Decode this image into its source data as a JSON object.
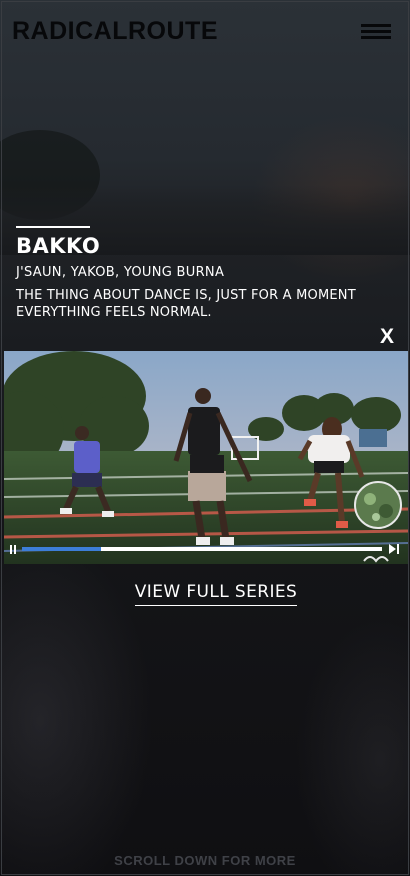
{
  "header": {
    "logo": "RADICALROUTE",
    "menu_icon": "hamburger-menu-icon"
  },
  "feature": {
    "title": "BAKKO",
    "artists": "J'SAUN, YAKOB, YOUNG BURNA",
    "quote": "THE THING ABOUT DANCE IS, JUST FOR A MOMENT EVERYTHING FEELS NORMAL."
  },
  "overlay": {
    "close_label": "X"
  },
  "video": {
    "description_icon": "dance-video-thumbnail",
    "progress": 0.22,
    "pause_icon": "pause-icon",
    "next_icon": "skip-next-icon"
  },
  "cta": {
    "view_full_series": "VIEW FULL SERIES"
  },
  "footer": {
    "scroll_hint": "SCROLL DOWN FOR MORE"
  },
  "colors": {
    "progress_fill": "#3d7ed8",
    "hint_text": "#3f4147"
  }
}
